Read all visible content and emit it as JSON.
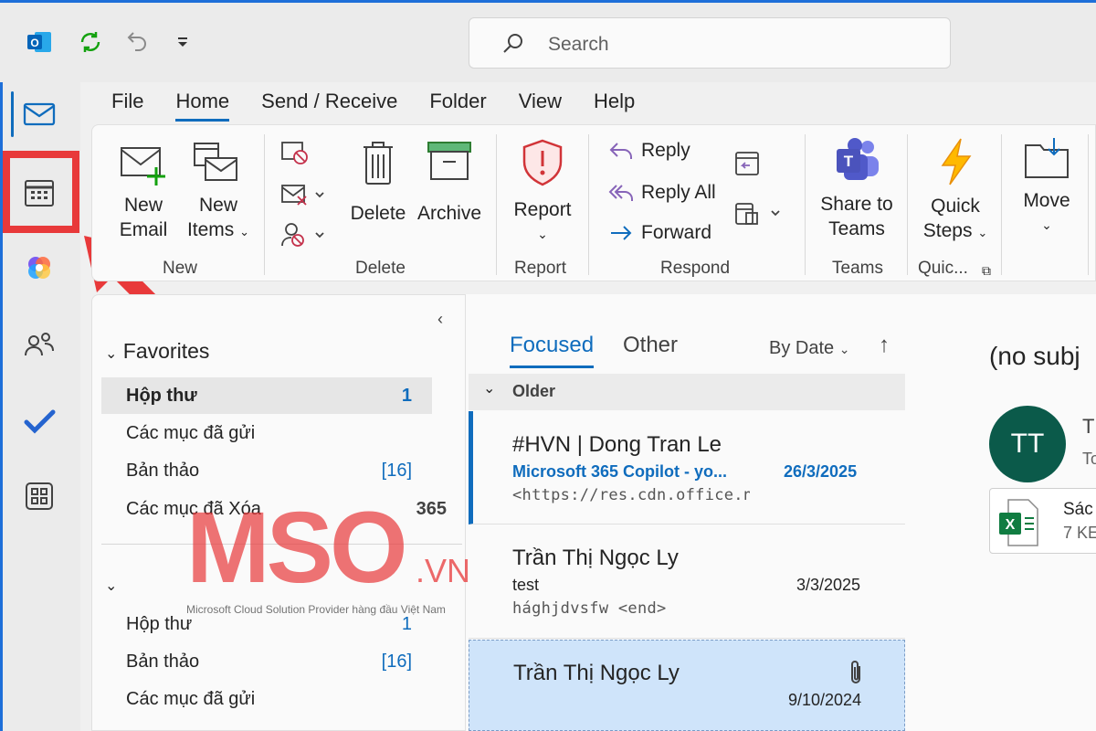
{
  "search": {
    "placeholder": "Search"
  },
  "menu": {
    "tabs": [
      "File",
      "Home",
      "Send / Receive",
      "Folder",
      "View",
      "Help"
    ],
    "active": "Home"
  },
  "ribbon": {
    "new_email": [
      "New",
      "Email"
    ],
    "new_items": [
      "New",
      "Items"
    ],
    "delete": "Delete",
    "archive": "Archive",
    "report": "Report",
    "reply": "Reply",
    "reply_all": "Reply All",
    "forward": "Forward",
    "share_teams": [
      "Share to",
      "Teams"
    ],
    "quick_steps": [
      "Quick",
      "Steps"
    ],
    "move": "Move",
    "groups": {
      "new": "New",
      "delete": "Delete",
      "report": "Report",
      "respond": "Respond",
      "teams": "Teams",
      "quick": "Quic..."
    }
  },
  "folders": {
    "favorites_label": "Favorites",
    "favorites": [
      {
        "name": "Hộp thư",
        "count": "1"
      },
      {
        "name": "Các mục đã gửi",
        "count": ""
      },
      {
        "name": "Bản thảo",
        "count": "[16]"
      },
      {
        "name": "Các mục đã Xóa",
        "count": "365"
      }
    ],
    "account": [
      {
        "name": "Hộp thư",
        "count": "1"
      },
      {
        "name": "Bản thảo",
        "count": "[16]"
      },
      {
        "name": "Các mục đã gửi",
        "count": ""
      }
    ]
  },
  "mail_list": {
    "tab_focused": "Focused",
    "tab_other": "Other",
    "sort": "By Date",
    "group": "Older",
    "items": [
      {
        "sender": "#HVN | Dong Tran Le",
        "subject": "Microsoft 365 Copilot - yo...",
        "date": "26/3/2025",
        "preview": "<https://res.cdn.office.net/ac"
      },
      {
        "sender": "Trần Thị Ngọc Ly",
        "subject": "test",
        "date": "3/3/2025",
        "preview": "hághjdvsfw <end>"
      },
      {
        "sender": "Trần Thị Ngọc Ly",
        "subject": "",
        "date": "9/10/2024",
        "preview": ""
      }
    ]
  },
  "reading": {
    "subject": "(no subj",
    "avatar_initials": "TT",
    "sender_fragment": "T",
    "to_fragment": "To",
    "attachment_name": "Sác",
    "attachment_size": "7 KE"
  },
  "watermark": {
    "brand": "MSO",
    "domain": ".VN",
    "tagline": "Microsoft Cloud Solution Provider hàng đầu Việt Nam"
  },
  "colors": {
    "accent": "#0f6cbd",
    "highlight": "#e8393a",
    "selected_mail": "#cfe4fa",
    "avatar": "#0b5a4a"
  }
}
